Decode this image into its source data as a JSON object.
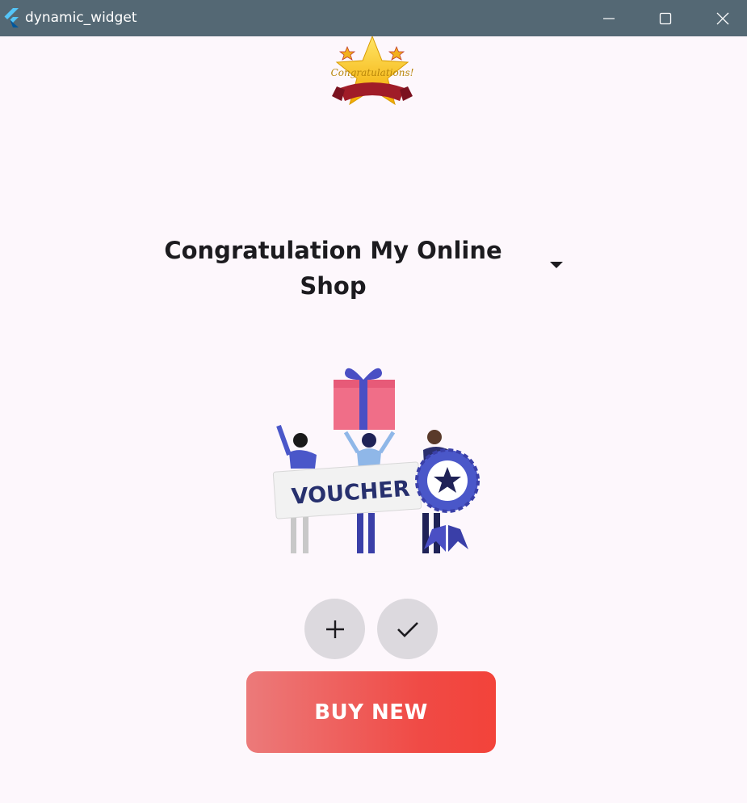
{
  "window": {
    "title": "dynamic_widget",
    "controls": [
      "minimize-icon",
      "maximize-icon",
      "close-icon"
    ]
  },
  "banner": {
    "text": "Congratulations!",
    "icon": "star-ribbon-banner"
  },
  "heading": {
    "text": "Congratulation My Online Shop"
  },
  "dropdown": {
    "icon": "caret-down-icon"
  },
  "illustration": {
    "voucher_text": "VOUCHER",
    "icon": "gift-voucher-illustration"
  },
  "actions": {
    "add_icon": "plus-icon",
    "check_icon": "check-icon"
  },
  "buy_button": {
    "label": "BUY NEW"
  },
  "colors": {
    "titlebar": "#546874",
    "background": "#fdf7fc",
    "circle_button": "#dcd9de",
    "buy_gradient_start": "#ec7a7a",
    "buy_gradient_end": "#f3433a"
  }
}
